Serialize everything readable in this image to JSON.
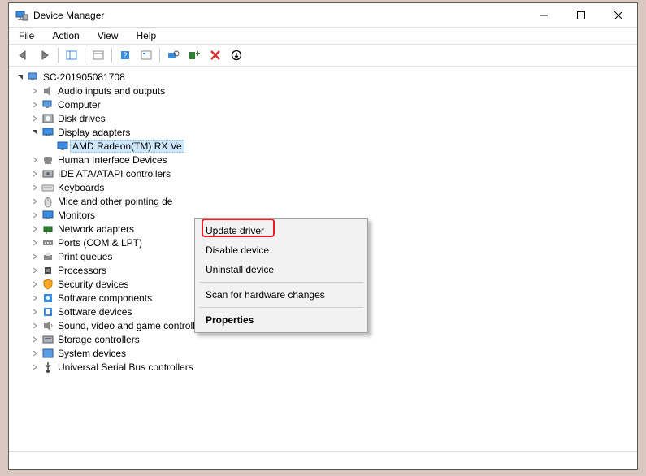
{
  "titlebar": {
    "title": "Device Manager"
  },
  "menu": {
    "file": "File",
    "action": "Action",
    "view": "View",
    "help": "Help"
  },
  "root": "SC-201905081708",
  "cats": {
    "audio": "Audio inputs and outputs",
    "computer": "Computer",
    "disk": "Disk drives",
    "display": "Display adapters",
    "display_child": "AMD Radeon(TM) RX Ve",
    "hid": "Human Interface Devices",
    "ide": "IDE ATA/ATAPI controllers",
    "keyboard": "Keyboards",
    "mice": "Mice and other pointing de",
    "monitors": "Monitors",
    "network": "Network adapters",
    "ports": "Ports (COM & LPT)",
    "print": "Print queues",
    "proc": "Processors",
    "security": "Security devices",
    "swcomp": "Software components",
    "swdev": "Software devices",
    "sound": "Sound, video and game controllers",
    "storage": "Storage controllers",
    "system": "System devices",
    "usb": "Universal Serial Bus controllers"
  },
  "ctx": {
    "update": "Update driver",
    "disable": "Disable device",
    "uninstall": "Uninstall device",
    "scan": "Scan for hardware changes",
    "props": "Properties"
  }
}
